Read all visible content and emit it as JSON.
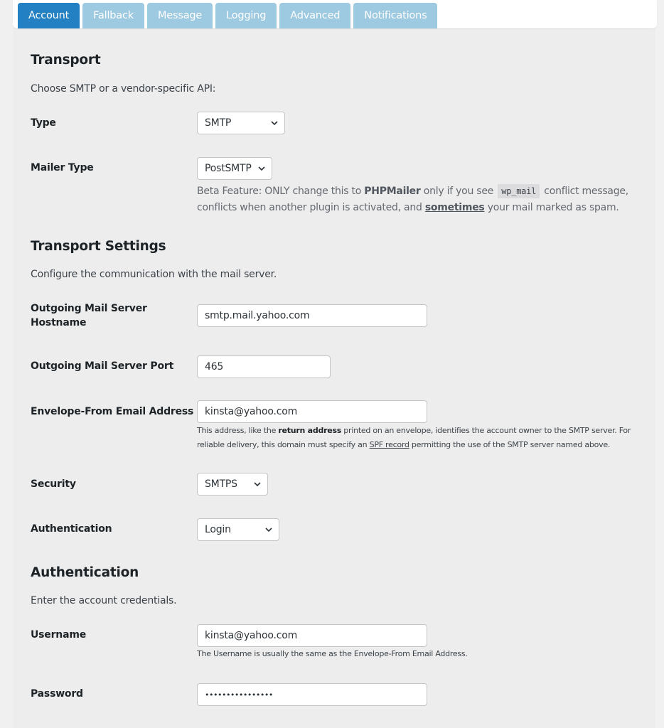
{
  "tabs": [
    {
      "label": "Account",
      "active": true
    },
    {
      "label": "Fallback",
      "active": false
    },
    {
      "label": "Message",
      "active": false
    },
    {
      "label": "Logging",
      "active": false
    },
    {
      "label": "Advanced",
      "active": false
    },
    {
      "label": "Notifications",
      "active": false
    }
  ],
  "colors": {
    "tab_active": "#2380c3",
    "tab_inactive": "#9ecae1",
    "page_bg": "#ededed"
  },
  "transport": {
    "title": "Transport",
    "intro": "Choose SMTP or a vendor-specific API:",
    "type": {
      "label": "Type",
      "value": "SMTP",
      "icon": "chevron-down-icon"
    },
    "mailer_type": {
      "label": "Mailer Type",
      "value": "PostSMTP",
      "icon": "chevron-down-icon",
      "desc": {
        "part1": "Beta Feature: ONLY change this to ",
        "bold": "PHPMailer",
        "part2": " only if you see ",
        "code": "wp_mail",
        "part3": " conflict message,",
        "line2a": "conflicts when another plugin is activated, and ",
        "underline": "sometimes",
        "line2b": " your mail marked as spam."
      }
    }
  },
  "transport_settings": {
    "title": "Transport Settings",
    "intro": "Configure the communication with the mail server.",
    "hostname": {
      "label_line1": "Outgoing Mail Server",
      "label_line2": "Hostname",
      "value": "smtp.mail.yahoo.com"
    },
    "port": {
      "label": "Outgoing Mail Server Port",
      "value": "465"
    },
    "envelope_from": {
      "label": "Envelope-From Email Address",
      "value": "kinsta@yahoo.com",
      "help": {
        "part1": "This address, like the ",
        "bold": "return address",
        "part2": " printed on an envelope, identifies the account owner to the SMTP server. For",
        "line2a": "reliable delivery, this domain must specify an ",
        "link": "SPF record",
        "line2b": " permitting the use of the SMTP server named above."
      }
    },
    "security": {
      "label": "Security",
      "value": "SMTPS",
      "icon": "chevron-down-icon"
    },
    "authentication": {
      "label": "Authentication",
      "value": "Login",
      "icon": "chevron-down-icon"
    }
  },
  "authentication": {
    "title": "Authentication",
    "intro": "Enter the account credentials.",
    "username": {
      "label": "Username",
      "value": "kinsta@yahoo.com",
      "help": "The Username is usually the same as the Envelope-From Email Address."
    },
    "password": {
      "label": "Password",
      "value": "••••••••••••••••"
    }
  }
}
